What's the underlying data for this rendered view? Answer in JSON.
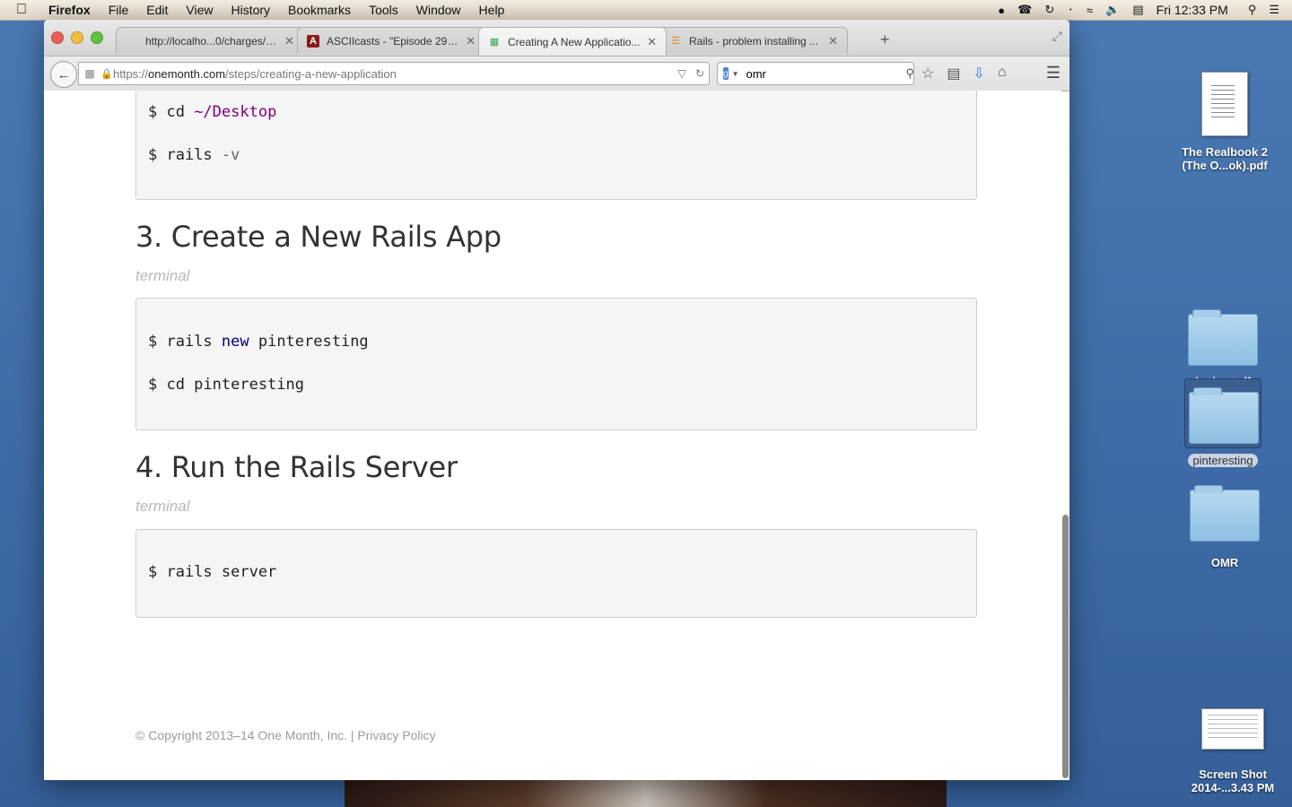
{
  "menubar": {
    "app": "Firefox",
    "items": [
      "File",
      "Edit",
      "View",
      "History",
      "Bookmarks",
      "Tools",
      "Window",
      "Help"
    ],
    "clock": "Fri 12:33 PM"
  },
  "browser": {
    "tabs": [
      {
        "label": "http://localho...0/charges/new",
        "icon": "blank-page-icon"
      },
      {
        "label": "ASCIIcasts - \"Episode 298...",
        "icon": "asciicasts-icon"
      },
      {
        "label": "Creating A New Applicatio...",
        "icon": "onemonth-icon",
        "active": true
      },
      {
        "label": "Rails - problem installing ...",
        "icon": "stackoverflow-icon"
      }
    ],
    "url_prefix": "https://",
    "url_domain": "onemonth.com",
    "url_path": "/steps/creating-a-new-application",
    "search_value": "omr"
  },
  "page": {
    "code_top": {
      "line1_cmd": "$ cd ",
      "line1_path": "~/Desktop",
      "line2_cmd": "$ rails ",
      "line2_flag": "-v"
    },
    "section3": {
      "heading": "3. Create a New Rails App",
      "label": "terminal",
      "line1_pre": "$ rails ",
      "line1_kw": "new",
      "line1_post": " pinteresting",
      "line2": "$ cd pinteresting"
    },
    "section4": {
      "heading": "4. Run the Rails Server",
      "label": "terminal",
      "line1": "$ rails server"
    },
    "footer": "© Copyright 2013–14 One Month, Inc. | Privacy Policy"
  },
  "desktop": {
    "icons": [
      {
        "label_line1": "The Realbook 2",
        "label_line2": "(The O...ok).pdf"
      },
      {
        "label": "logic stuff"
      },
      {
        "label": "pinteresting"
      },
      {
        "label": "OMR"
      },
      {
        "label_line1": "Screen Shot",
        "label_line2": "2014-...3.43 PM"
      }
    ]
  }
}
